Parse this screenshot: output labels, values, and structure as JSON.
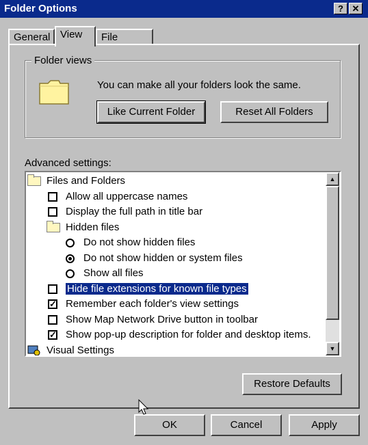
{
  "window": {
    "title": "Folder Options",
    "help_btn": "?",
    "close_btn": "✕"
  },
  "tabs": [
    {
      "label": "General"
    },
    {
      "label": "View"
    },
    {
      "label": "File Types"
    }
  ],
  "folder_views": {
    "legend": "Folder views",
    "text": "You can make all your folders look the same.",
    "like_current_btn": "Like Current Folder",
    "reset_all_btn": "Reset All Folders"
  },
  "advanced": {
    "label": "Advanced settings:",
    "items": [
      {
        "type": "folder",
        "label": "Files and Folders"
      },
      {
        "type": "checkbox",
        "checked": false,
        "label": "Allow all uppercase names"
      },
      {
        "type": "checkbox",
        "checked": false,
        "label": "Display the full path in title bar"
      },
      {
        "type": "folder",
        "label": "Hidden files"
      },
      {
        "type": "radio",
        "checked": false,
        "label": "Do not show hidden files"
      },
      {
        "type": "radio",
        "checked": true,
        "label": "Do not show hidden or system files"
      },
      {
        "type": "radio",
        "checked": false,
        "label": "Show all files"
      },
      {
        "type": "checkbox",
        "checked": false,
        "label": "Hide file extensions for known file types",
        "selected": true
      },
      {
        "type": "checkbox",
        "checked": true,
        "label": "Remember each folder's view settings"
      },
      {
        "type": "checkbox",
        "checked": false,
        "label": "Show Map Network Drive button in toolbar"
      },
      {
        "type": "checkbox",
        "checked": true,
        "label": "Show pop-up description for folder and desktop items."
      },
      {
        "type": "gear",
        "label": "Visual Settings"
      }
    ],
    "check_mark": "✓"
  },
  "buttons": {
    "restore": "Restore Defaults",
    "ok": "OK",
    "cancel": "Cancel",
    "apply": "Apply"
  },
  "scroll": {
    "up": "▲",
    "down": "▼"
  },
  "colors": {
    "titlebar": "#0a2a8c",
    "face": "#c0c0c0",
    "selection": "#0a2a8c"
  }
}
